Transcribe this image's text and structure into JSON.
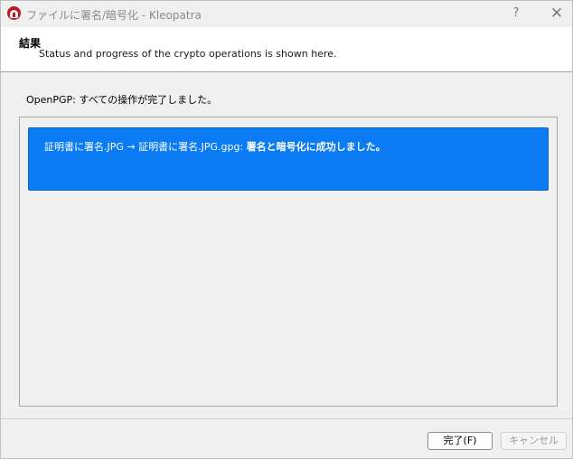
{
  "window": {
    "title": "ファイルに署名/暗号化 - Kleopatra",
    "help_label": "?",
    "close_label": "✕"
  },
  "header": {
    "title": "結果",
    "subtitle": "Status and progress of the crypto operations is shown here."
  },
  "status": {
    "text": "OpenPGP: すべての操作が完了しました。"
  },
  "results": [
    {
      "prefix": "証明書に署名.JPG → 証明書に署名.JPG.gpg: ",
      "message": "署名と暗号化に成功しました。",
      "color": "#0a7bf3"
    }
  ],
  "buttons": {
    "finish_label": "完了(F)",
    "cancel_label": "キャンセル"
  }
}
